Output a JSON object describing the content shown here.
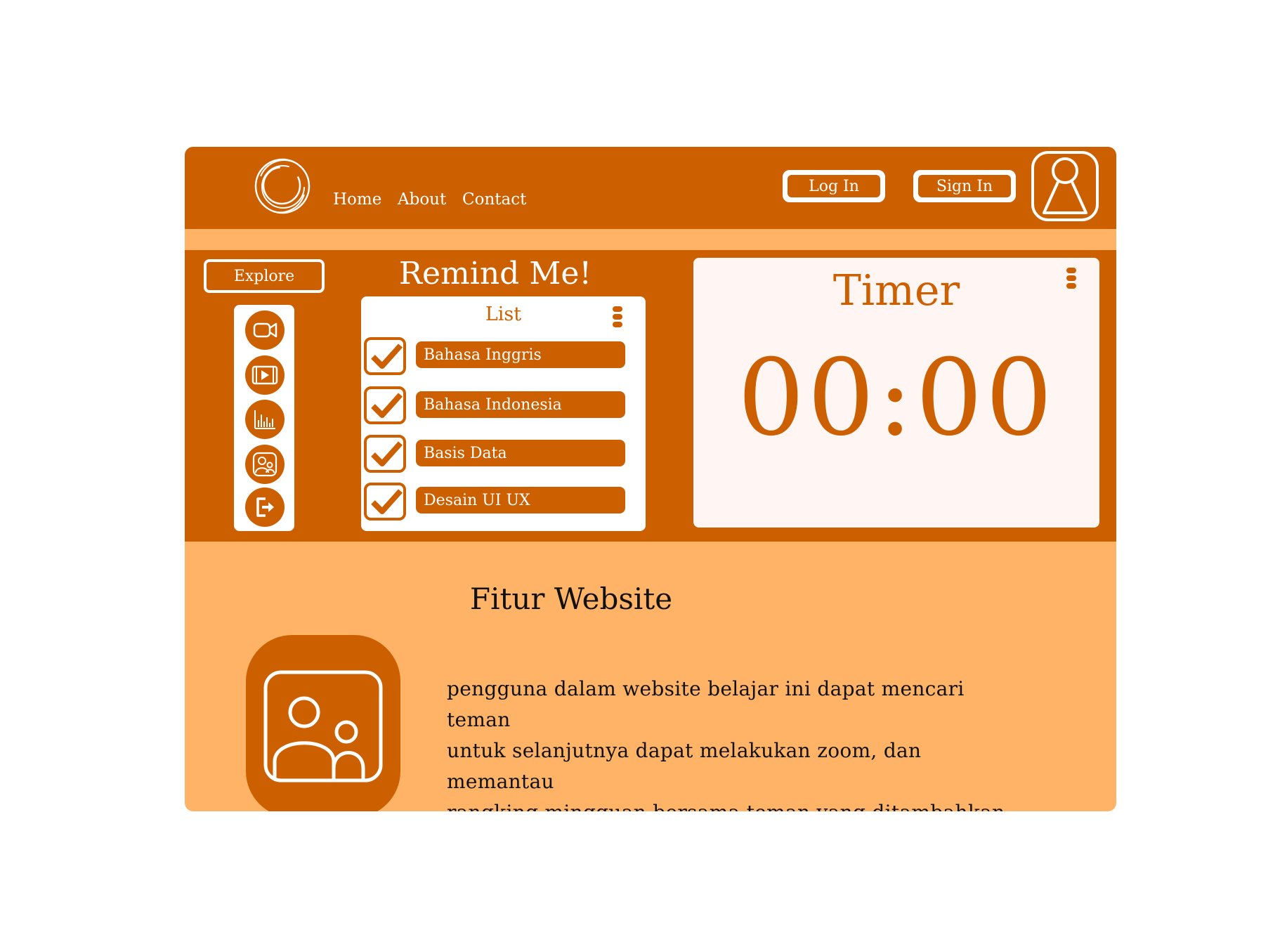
{
  "colors": {
    "primary": "#cc5f00",
    "accent": "#ffb366",
    "card": "#ffffff",
    "timer_card": "#fff5f3",
    "text_dark": "#111111"
  },
  "header": {
    "logo_icon": "circle-swirl-logo-icon",
    "nav": [
      "Home",
      "About",
      "Contact"
    ],
    "login_label": "Log In",
    "signin_label": "Sign In",
    "avatar_icon": "user-avatar-icon"
  },
  "sidebar": {
    "explore_label": "Explore",
    "icons": [
      "video-camera-icon",
      "film-play-icon",
      "bar-chart-icon",
      "friends-icon",
      "logout-icon"
    ]
  },
  "remind": {
    "title": "Remind Me!",
    "list_title": "List",
    "menu_icon": "kebab-menu-icon",
    "items": [
      {
        "label": "Bahasa Inggris",
        "checked": true
      },
      {
        "label": "Bahasa Indonesia",
        "checked": true
      },
      {
        "label": "Basis Data",
        "checked": true
      },
      {
        "label": "Desain UI UX",
        "checked": true
      }
    ]
  },
  "timer": {
    "title": "Timer",
    "value": "00:00",
    "menu_icon": "kebab-menu-icon"
  },
  "features": {
    "title": "Fitur Website",
    "icon": "friends-icon",
    "lines": [
      "pengguna dalam website belajar ini dapat mencari teman",
      "untuk selanjutnya dapat melakukan zoom, dan memantau",
      "rangking mingguan bersama teman yang ditambahkan."
    ]
  }
}
